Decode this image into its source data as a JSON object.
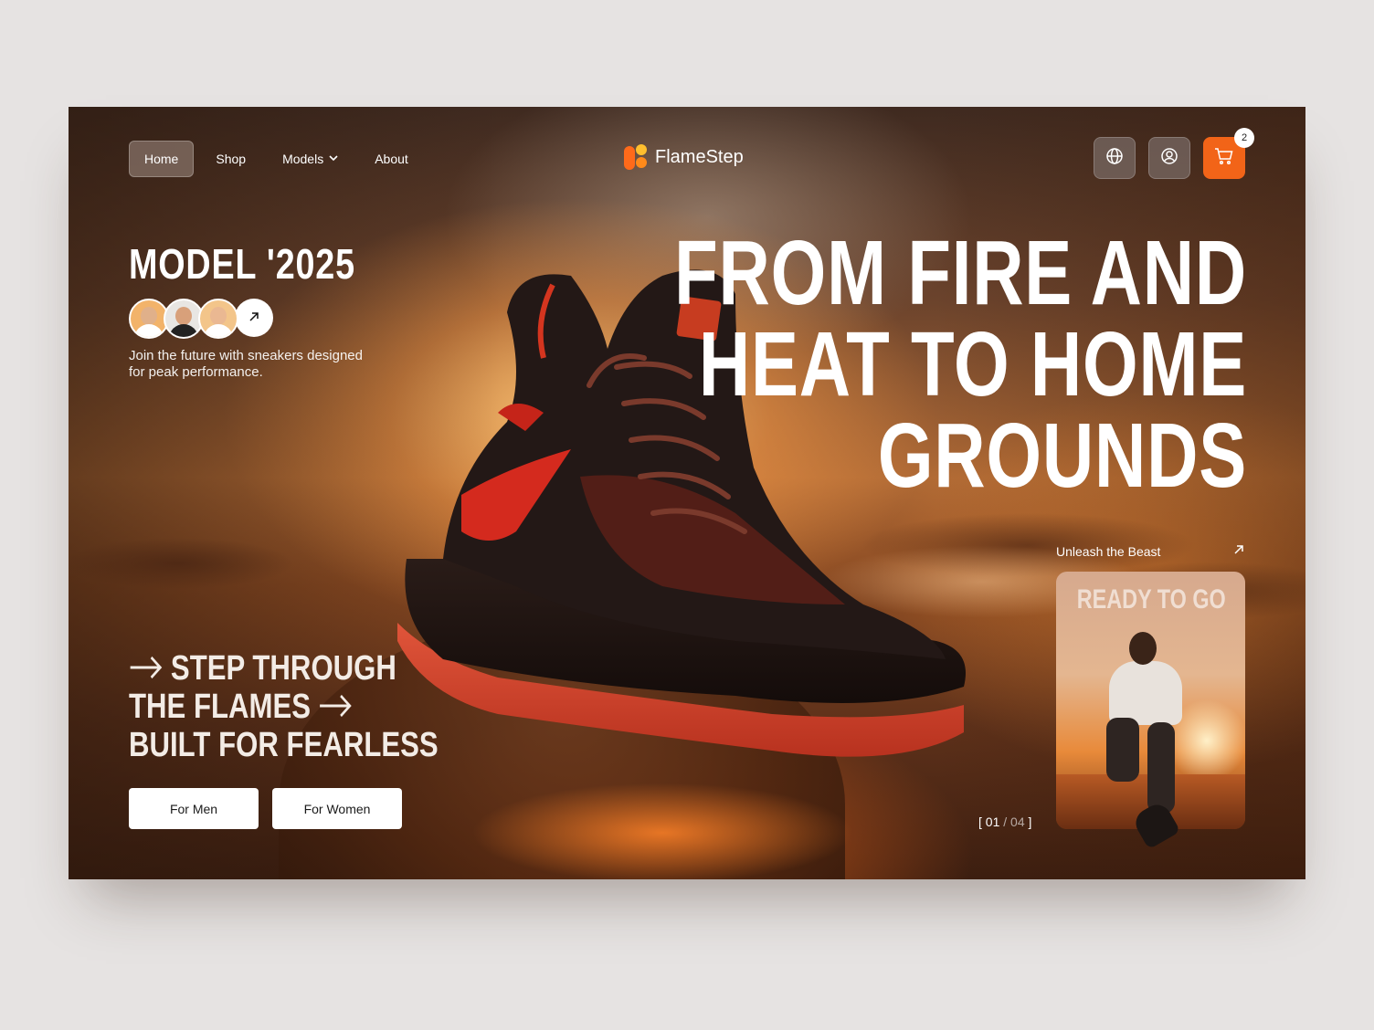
{
  "nav": {
    "items": [
      {
        "label": "Home",
        "active": true
      },
      {
        "label": "Shop",
        "active": false
      },
      {
        "label": "Models",
        "active": false,
        "has_dropdown": true
      },
      {
        "label": "About",
        "active": false
      }
    ]
  },
  "brand": {
    "name": "FlameStep",
    "colors": [
      "#ff6a1a",
      "#ffbf2e",
      "#ff8a1a"
    ]
  },
  "actions": {
    "language_icon": "globe-icon",
    "account_icon": "user-icon",
    "cart_icon": "cart-icon",
    "cart_count": "2",
    "cart_color": "#f26418"
  },
  "hero": {
    "model_title": "MODEL '2025",
    "avatar_arrow_icon": "arrow-up-right-icon",
    "tagline": "Join the future with sneakers designed for peak performance.",
    "headline": [
      "FROM FIRE AND",
      "HEAT TO HOME",
      "GROUNDS"
    ],
    "steps": [
      {
        "text": "STEP THROUGH",
        "arrow": "before"
      },
      {
        "text": "THE FLAMES",
        "arrow": "after"
      },
      {
        "text": "BUILT FOR FEARLESS",
        "arrow": "none"
      }
    ],
    "buttons": {
      "men": "For Men",
      "women": "For Women"
    }
  },
  "promo": {
    "heading": "Unleash the Beast",
    "card_title": "READY TO GO",
    "arrow_icon": "arrow-up-right-icon"
  },
  "pager": {
    "current": "01",
    "total": "04",
    "open": "[",
    "close": "]",
    "sep": "/"
  }
}
